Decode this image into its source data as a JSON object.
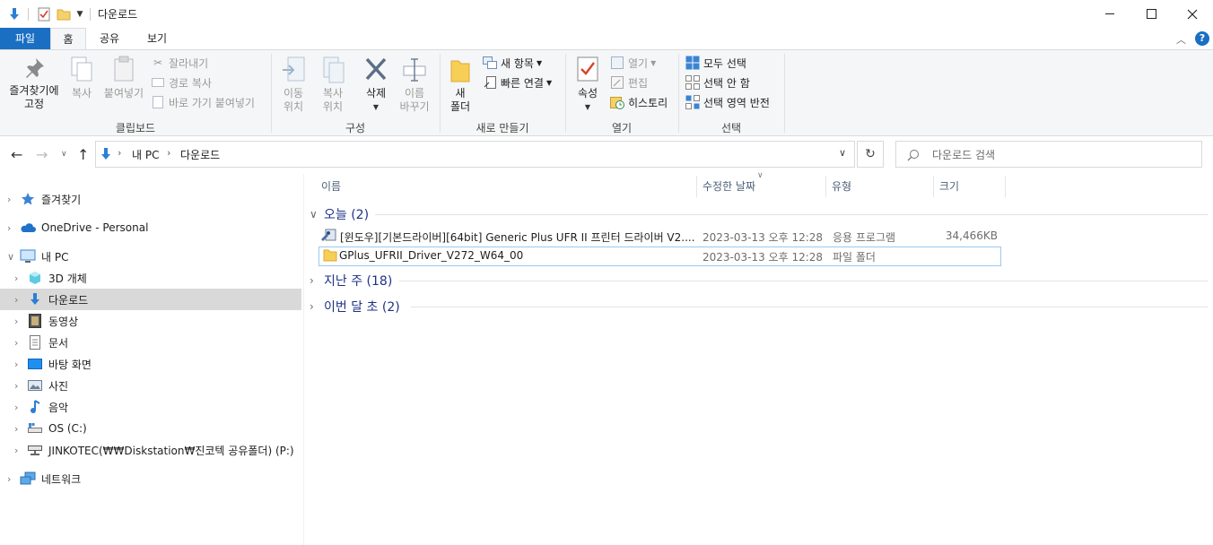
{
  "window": {
    "title": "다운로드",
    "minimize_icon": "minimize-icon",
    "maximize_icon": "maximize-icon",
    "close_icon": "close-icon"
  },
  "ribbon_tabs": [
    {
      "label": "파일"
    },
    {
      "label": "홈"
    },
    {
      "label": "공유"
    },
    {
      "label": "보기"
    }
  ],
  "ribbon": {
    "clipboard": {
      "pin_label": "즐겨찾기에\n고정",
      "copy_label": "복사",
      "paste_label": "붙여넣기",
      "cut_label": "잘라내기",
      "copy_path_label": "경로 복사",
      "paste_shortcut_label": "바로 가기 붙여넣기",
      "group_label": "클립보드"
    },
    "organize": {
      "move_label": "이동\n위치",
      "copy_to_label": "복사\n위치",
      "delete_label": "삭제",
      "rename_label": "이름\n바꾸기",
      "group_label": "구성"
    },
    "new": {
      "new_folder_label": "새\n폴더",
      "new_item_label": "새 항목",
      "easy_access_label": "빠른 연결",
      "group_label": "새로 만들기"
    },
    "open": {
      "properties_label": "속성",
      "open_label": "열기",
      "edit_label": "편집",
      "history_label": "히스토리",
      "group_label": "열기"
    },
    "select": {
      "select_all_label": "모두 선택",
      "select_none_label": "선택 안 함",
      "invert_label": "선택 영역 반전",
      "group_label": "선택"
    }
  },
  "address": {
    "segments": [
      "내 PC",
      "다운로드"
    ],
    "search_placeholder": "다운로드 검색"
  },
  "nav_pane": {
    "items": [
      {
        "label": "즐겨찾기",
        "icon": "star-icon"
      },
      {
        "label": "OneDrive - Personal",
        "icon": "cloud-icon"
      },
      {
        "label": "내 PC",
        "icon": "computer-icon"
      },
      {
        "label": "3D 개체",
        "icon": "cube-icon"
      },
      {
        "label": "다운로드",
        "icon": "download-icon"
      },
      {
        "label": "동영상",
        "icon": "video-icon"
      },
      {
        "label": "문서",
        "icon": "document-icon"
      },
      {
        "label": "바탕 화면",
        "icon": "desktop-icon"
      },
      {
        "label": "사진",
        "icon": "picture-icon"
      },
      {
        "label": "음악",
        "icon": "music-icon"
      },
      {
        "label": "OS (C:)",
        "icon": "drive-icon"
      },
      {
        "label": "JINKOTEC(₩₩Diskstation₩진코텍 공유폴더) (P:)",
        "icon": "network-drive-icon"
      },
      {
        "label": "네트워크",
        "icon": "network-icon"
      }
    ]
  },
  "columns": {
    "name": "이름",
    "date": "수정한 날짜",
    "type": "유형",
    "size": "크기"
  },
  "groups": [
    {
      "label": "오늘 (2)"
    },
    {
      "label": "지난 주 (18)"
    },
    {
      "label": "이번 달 초 (2)"
    }
  ],
  "files": [
    {
      "name": "[윈도우][기본드라이버][64bit] Generic Plus UFR II 프린터 드라이버 V2....",
      "date": "2023-03-13 오후 12:28",
      "type": "응용 프로그램",
      "size": "34,466KB",
      "icon": "installer-icon"
    },
    {
      "name": "GPlus_UFRII_Driver_V272_W64_00",
      "date": "2023-03-13 오후 12:28",
      "type": "파일 폴더",
      "size": "",
      "icon": "folder-icon"
    }
  ]
}
